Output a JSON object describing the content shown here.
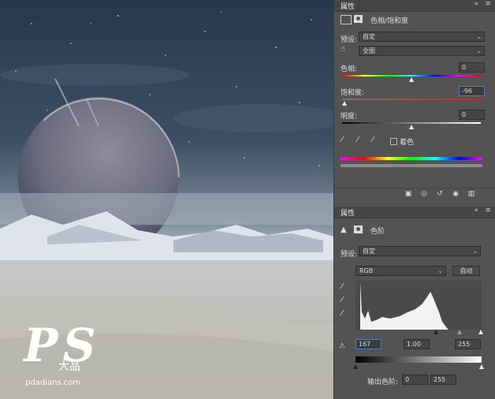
{
  "hue_sat_panel": {
    "tab_label": "属性",
    "title": "色相/饱和度",
    "preset_label": "预设:",
    "preset_value": "自定",
    "channel_value": "全图",
    "hue_label": "色相:",
    "hue_value": "0",
    "saturation_label": "饱和度:",
    "saturation_value": "-96",
    "lightness_label": "明度:",
    "lightness_value": "0",
    "colorize_label": "着色"
  },
  "levels_panel": {
    "tab_label": "属性",
    "title": "色阶",
    "preset_label": "预设:",
    "preset_value": "自定",
    "channel_value": "RGB",
    "auto_label": "自动",
    "input_black": "167",
    "input_gamma": "1.00",
    "input_white": "255",
    "output_label": "输出色阶:",
    "output_black": "0",
    "output_white": "255"
  },
  "controls": {
    "collapse_icon": "»",
    "menu_icon": "≡"
  },
  "watermark": {
    "logo_text": "PS",
    "logo_sub": "大品",
    "site": "pdadians.com"
  },
  "colors": {
    "panel_bg": "#535353",
    "input_highlight": "#4d7ec6"
  }
}
